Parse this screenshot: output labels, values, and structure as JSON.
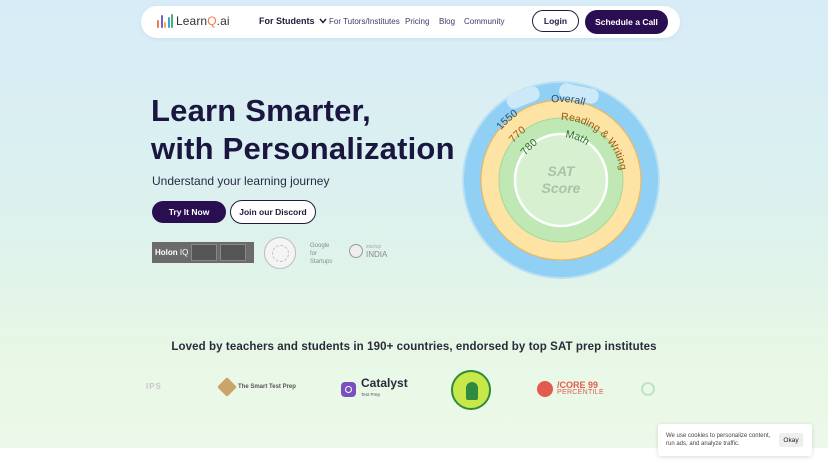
{
  "brand": {
    "name_main": "Learn",
    "name_q": "Q",
    "name_suffix": ".ai",
    "bar_colors": [
      "#f07a4a",
      "#7a5cc9",
      "#f2b134",
      "#3aa7d8",
      "#4caf6a"
    ]
  },
  "nav": {
    "students": "For Students",
    "tutors": "For Tutors/Institutes",
    "pricing": "Pricing",
    "blog": "Blog",
    "community": "Community",
    "login": "Login",
    "schedule": "Schedule a Call"
  },
  "hero": {
    "title_line1": "Learn Smarter,",
    "title_line2": "with Personalization",
    "subtitle": "Understand your learning journey",
    "primary_cta": "Try It Now",
    "secondary_cta": "Join our Discord"
  },
  "awards": {
    "holon": "Holon",
    "holon_iq": "IQ",
    "google_line1": "Google",
    "google_line2": "for",
    "google_line3": "Startups",
    "startup_small": "startup",
    "startup_india": "INDIA"
  },
  "score_ring": {
    "center_line1": "SAT",
    "center_line2": "Score",
    "overall_label": "Overall",
    "overall_value": "1550",
    "rw_label": "Reading & Writing",
    "rw_value": "770",
    "math_label": "Math",
    "math_value": "780",
    "colors": {
      "outer": "#8fd0f4",
      "middle": "#fde3a4",
      "inner": "#bfe8b4",
      "center": "#d6f0d0"
    }
  },
  "partners": {
    "heading": "Loved by teachers and students in 190+ countries, endorsed by top SAT prep institutes",
    "ips": "IPS",
    "smart": "The Smart Test Prep",
    "catalyst": "Catalyst",
    "catalyst_sub": "Test Prep",
    "score99": "/CORE 99",
    "score99_sub": "PERCENTILE"
  },
  "cookie": {
    "text": "We use cookies to personalize content, run ads, and analyze traffic.",
    "okay": "Okay"
  }
}
